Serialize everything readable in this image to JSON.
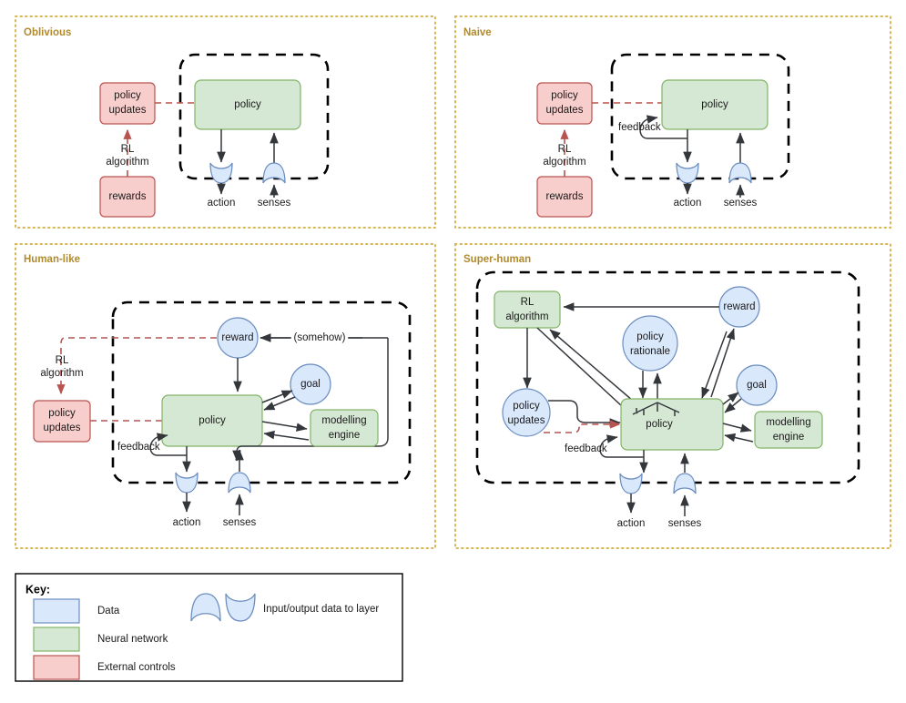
{
  "panels": [
    {
      "id": "oblivious",
      "title": "Oblivious",
      "nodes": {
        "policy_updates": "policy\nupdates",
        "rewards": "rewards",
        "policy": "policy",
        "action": "action",
        "senses": "senses"
      },
      "edge_labels": {
        "rl_algorithm": "RL\nalgorithm"
      }
    },
    {
      "id": "naive",
      "title": "Naive",
      "nodes": {
        "policy_updates": "policy\nupdates",
        "rewards": "rewards",
        "policy": "policy",
        "action": "action",
        "senses": "senses"
      },
      "edge_labels": {
        "rl_algorithm": "RL\nalgorithm",
        "feedback": "feedback"
      }
    },
    {
      "id": "human-like",
      "title": "Human-like",
      "nodes": {
        "policy_updates": "policy\nupdates",
        "policy": "policy",
        "reward": "reward",
        "goal": "goal",
        "modelling_engine": "modelling\nengine",
        "action": "action",
        "senses": "senses"
      },
      "edge_labels": {
        "rl_algorithm": "RL\nalgorithm",
        "feedback": "feedback",
        "somehow": "(somehow)"
      }
    },
    {
      "id": "super-human",
      "title": "Super-human",
      "nodes": {
        "rl_algorithm": "RL\nalgorithm",
        "policy_updates": "policy\nupdates",
        "policy_rationale": "policy\nrationale",
        "reward": "reward",
        "goal": "goal",
        "modelling_engine": "modelling\nengine",
        "policy": "policy",
        "action": "action",
        "senses": "senses"
      },
      "edge_labels": {
        "feedback": "feedback"
      }
    }
  ],
  "key": {
    "title": "Key:",
    "rows": [
      {
        "swatch": "data",
        "label": "Data",
        "color": "#dae8fc"
      },
      {
        "swatch": "neural-network",
        "label": "Neural network",
        "color": "#d5e8d4"
      },
      {
        "swatch": "external-controls",
        "label": "External controls",
        "color": "#f8cecc"
      }
    ],
    "blob_label": "Input/output data to layer"
  },
  "colors": {
    "panel_border": "#d6b656",
    "panel_title": "#b08a2e",
    "data_fill": "#dae8fc",
    "data_stroke": "#6c8ebf",
    "nn_fill": "#d5e8d4",
    "nn_stroke": "#82b366",
    "ext_fill": "#f8cecc",
    "ext_stroke": "#b85450",
    "arrow": "#33373b",
    "arrow_red": "#b85450"
  }
}
